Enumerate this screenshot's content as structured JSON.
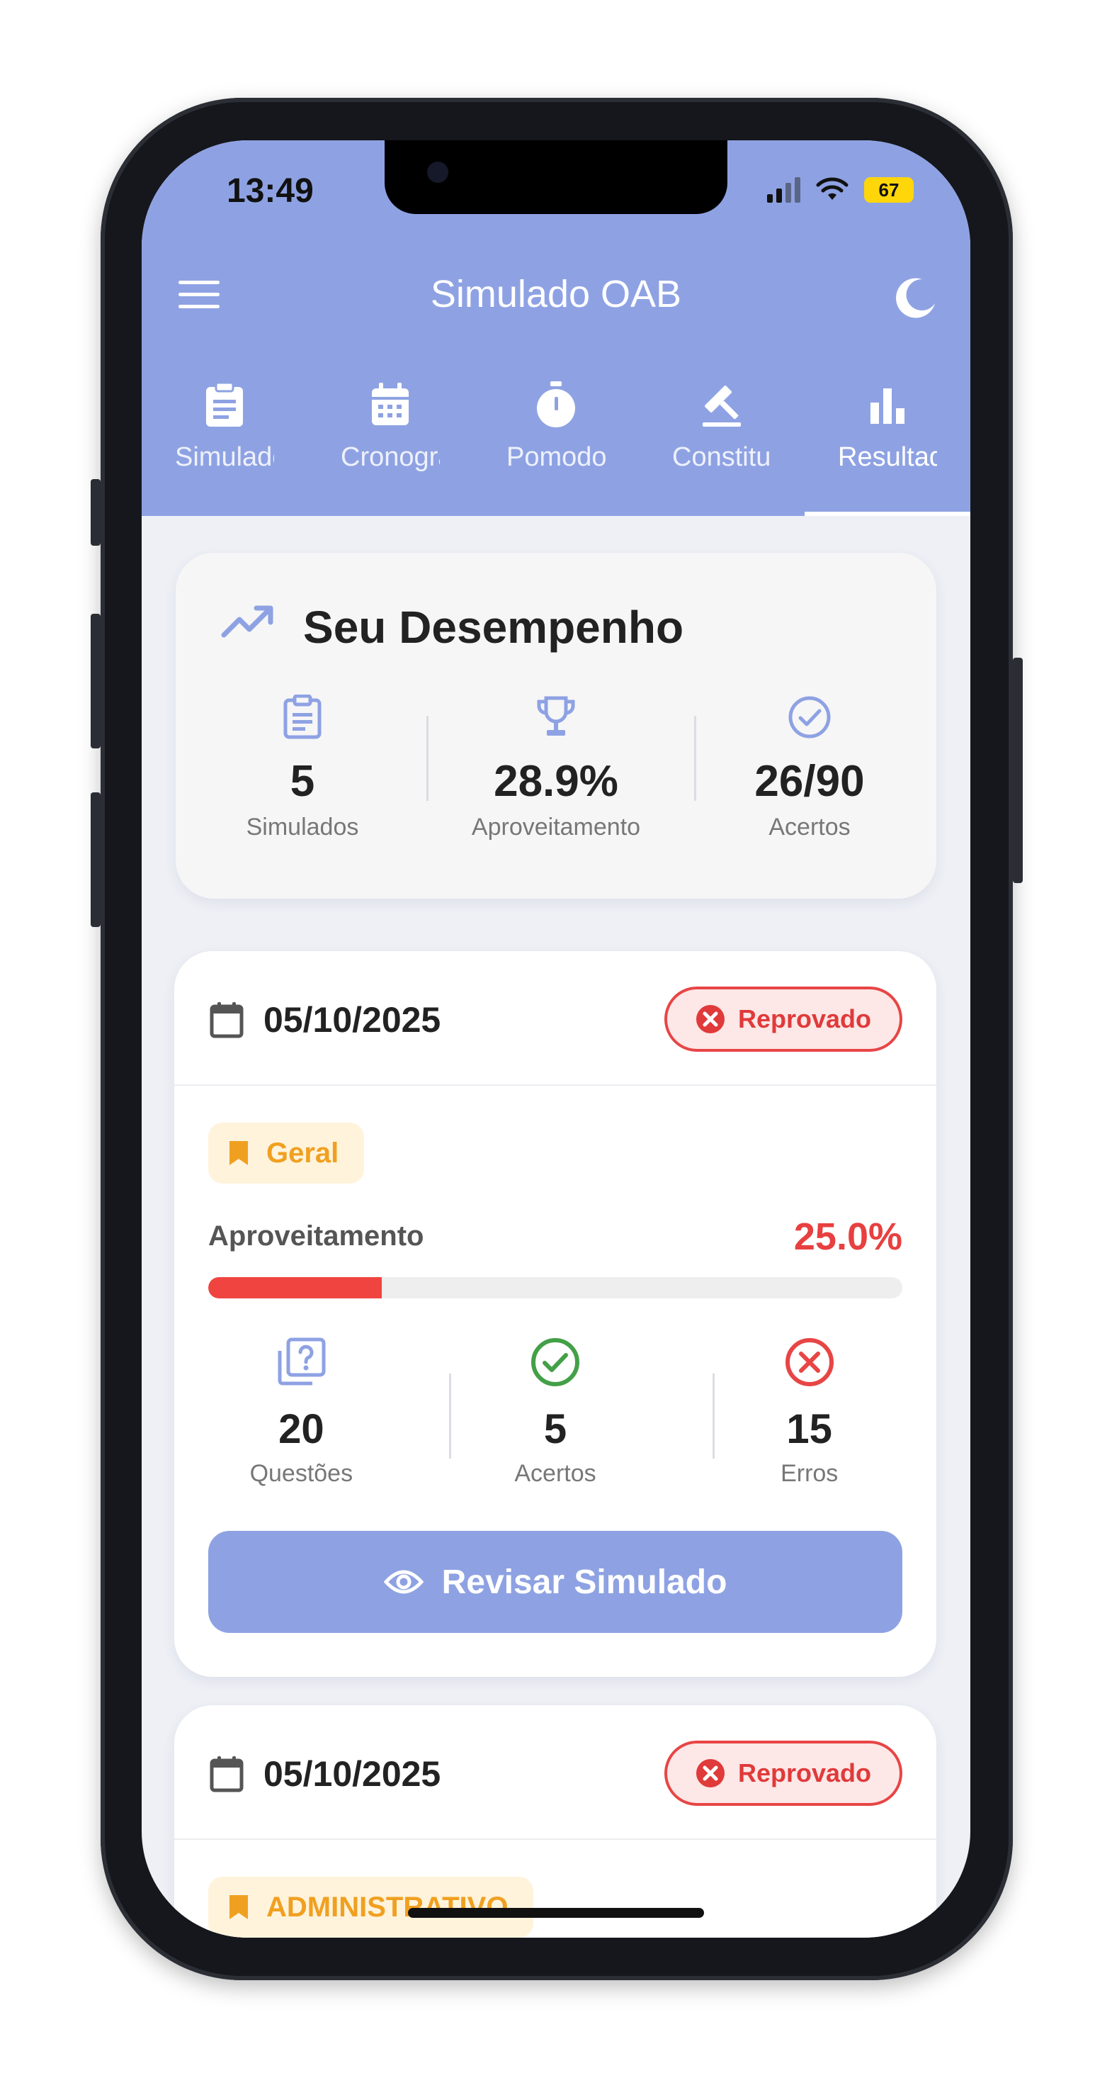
{
  "status_bar": {
    "time": "13:49",
    "battery": "67"
  },
  "app_bar": {
    "title": "Simulado OAB"
  },
  "tabs": [
    {
      "label": "Simulados",
      "icon": "clipboard-icon"
    },
    {
      "label": "Cronograma",
      "icon": "calendar-icon"
    },
    {
      "label": "Pomodoro",
      "icon": "timer-icon"
    },
    {
      "label": "Constituição",
      "icon": "gavel-icon"
    },
    {
      "label": "Resultados",
      "icon": "bar-chart-icon",
      "active": true
    }
  ],
  "performance": {
    "title": "Seu Desempenho",
    "stats": [
      {
        "value": "5",
        "label": "Simulados",
        "icon": "clipboard-icon"
      },
      {
        "value": "28.9%",
        "label": "Aproveitamento",
        "icon": "trophy-icon"
      },
      {
        "value": "26/90",
        "label": "Acertos",
        "icon": "check-circle-icon"
      }
    ]
  },
  "simulations": [
    {
      "date": "05/10/2025",
      "status": "Reprovado",
      "category": "Geral",
      "aproveitamento_label": "Aproveitamento",
      "aproveitamento": "25.0%",
      "progress": 0.25,
      "stats": [
        {
          "value": "20",
          "label": "Questões"
        },
        {
          "value": "5",
          "label": "Acertos"
        },
        {
          "value": "15",
          "label": "Erros"
        }
      ],
      "review_label": "Revisar Simulado"
    },
    {
      "date": "05/10/2025",
      "status": "Reprovado",
      "category": "ADMINISTRATIVO"
    }
  ],
  "colors": {
    "primary": "#8ea2e3",
    "danger": "#e84545",
    "success": "#43a047",
    "warning": "#f0a020"
  }
}
